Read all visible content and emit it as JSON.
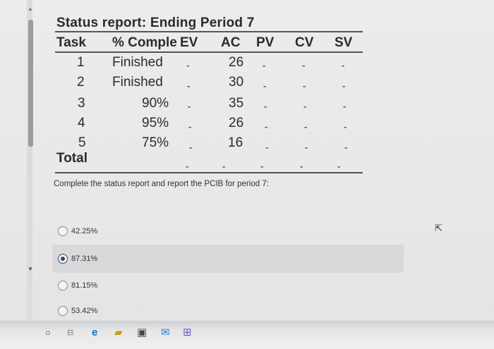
{
  "report": {
    "title": "Status report: Ending Period 7",
    "headers": {
      "task": "Task",
      "pct": "% Comple",
      "ev": "EV",
      "ac": "AC",
      "pv": "PV",
      "cv": "CV",
      "sv": "SV"
    },
    "rows": [
      {
        "task": "1",
        "pct": "Finished",
        "ac": "26"
      },
      {
        "task": "2",
        "pct": "Finished",
        "ac": "30"
      },
      {
        "task": "3",
        "pct": "90%",
        "ac": "35"
      },
      {
        "task": "4",
        "pct": "95%",
        "ac": "26"
      },
      {
        "task": "5",
        "pct": "75%",
        "ac": "16"
      }
    ],
    "total_label": "Total",
    "blank_mark": "-"
  },
  "question": {
    "prompt": "Complete the status report and report the PCIB for period 7:",
    "options": [
      {
        "label": "42.25%",
        "selected": false
      },
      {
        "label": "87.31%",
        "selected": true
      },
      {
        "label": "81.15%",
        "selected": false
      },
      {
        "label": "53.42%",
        "selected": false
      }
    ]
  },
  "taskbar": {
    "icons": [
      "start-circle-icon",
      "task-view-icon",
      "edge-browser-icon",
      "file-explorer-icon",
      "store-bag-icon",
      "mail-icon",
      "network-icon"
    ]
  },
  "colors": {
    "radio_selected": "#2e4a6e",
    "selected_band": "#d9d9dc"
  }
}
